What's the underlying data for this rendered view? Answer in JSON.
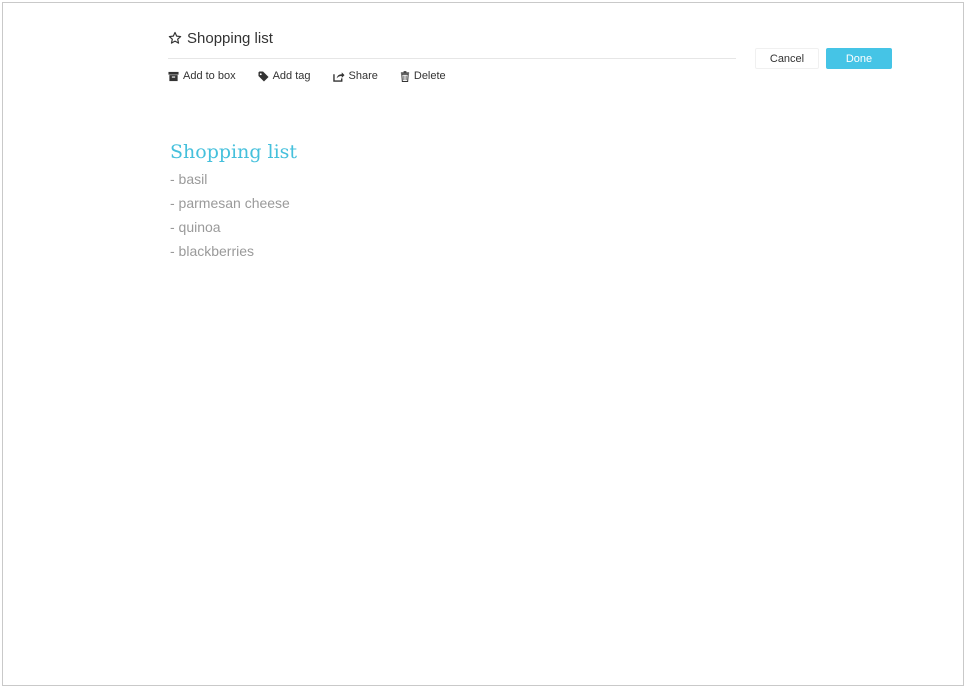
{
  "note": {
    "header_title": "Shopping list",
    "toolbar": {
      "add_to_box": "Add to box",
      "add_tag": "Add tag",
      "share": "Share",
      "delete": "Delete"
    },
    "buttons": {
      "cancel": "Cancel",
      "done": "Done"
    },
    "content": {
      "title": "Shopping list",
      "lines": [
        "- basil",
        "- parmesan cheese",
        "- quinoa",
        "- blackberries"
      ]
    }
  },
  "colors": {
    "accent": "#45c4e6",
    "note_title": "#45c0dc",
    "body_text": "#9a9a9a"
  },
  "icons": [
    "star-outline-icon",
    "box-icon",
    "tag-icon",
    "share-icon",
    "trash-icon"
  ]
}
